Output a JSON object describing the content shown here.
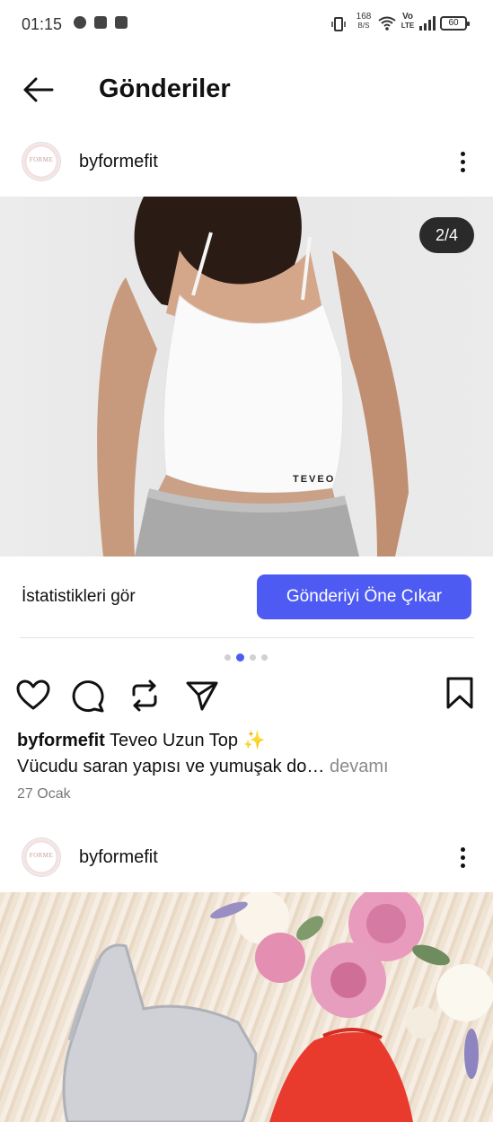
{
  "status_bar": {
    "time": "01:15",
    "net_speed_value": "168",
    "net_speed_unit": "B/S",
    "volte_top": "Vo",
    "volte_bottom": "LTE",
    "battery": "60"
  },
  "header": {
    "title": "Gönderiler"
  },
  "posts": [
    {
      "username": "byformefit",
      "avatar_text": "FORME",
      "image_counter": "2/4",
      "image_print": "TEVEO",
      "stats_label": "İstatistikleri gör",
      "promote_label": "Gönderiyi Öne Çıkar",
      "carousel_pages": 4,
      "carousel_active": 2,
      "caption_user": "byformefit",
      "caption_text": "Teveo Uzun Top ✨",
      "caption_line2": "Vücudu saran yapısı ve yumuşak do…",
      "caption_more": "devamı",
      "date": "27 Ocak"
    },
    {
      "username": "byformefit",
      "avatar_text": "FORME"
    }
  ],
  "icons": {
    "back": "arrow-left-icon",
    "like": "heart-icon",
    "comment": "comment-icon",
    "repost": "repost-icon",
    "share": "send-icon",
    "save": "bookmark-icon",
    "more": "more-vertical-icon"
  },
  "colors": {
    "accent": "#4e5bf2",
    "counter_bg": "#2a2a2a",
    "pager_active": "#4e5bf2",
    "pager_inactive": "#d0d0d0"
  }
}
